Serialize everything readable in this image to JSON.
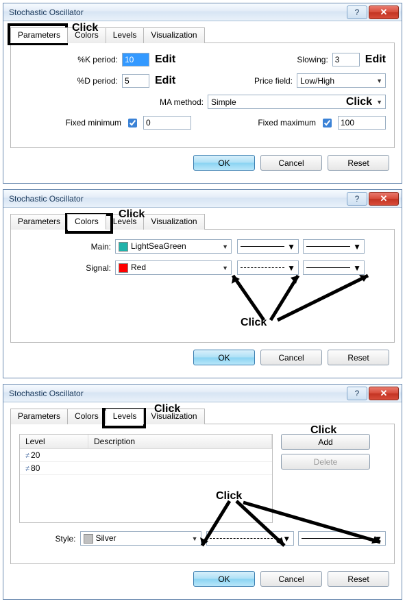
{
  "title": "Stochastic Oscillator",
  "tabs": {
    "parameters": "Parameters",
    "colors": "Colors",
    "levels": "Levels",
    "visualization": "Visualization"
  },
  "buttons": {
    "ok": "OK",
    "cancel": "Cancel",
    "reset": "Reset",
    "add": "Add",
    "delete": "Delete"
  },
  "annotations": {
    "click": "Click",
    "edit": "Edit"
  },
  "dlg1": {
    "k_period_label": "%K period:",
    "k_period_value": "10",
    "slowing_label": "Slowing:",
    "slowing_value": "3",
    "d_period_label": "%D period:",
    "d_period_value": "5",
    "price_field_label": "Price field:",
    "price_field_value": "Low/High",
    "ma_method_label": "MA method:",
    "ma_method_value": "Simple",
    "fixed_min_label": "Fixed minimum",
    "fixed_min_value": "0",
    "fixed_max_label": "Fixed maximum",
    "fixed_max_value": "100"
  },
  "dlg2": {
    "main_label": "Main:",
    "main_color_name": "LightSeaGreen",
    "main_color": "#20B2AA",
    "signal_label": "Signal:",
    "signal_color_name": "Red",
    "signal_color": "#ff0000"
  },
  "dlg3": {
    "col_level": "Level",
    "col_desc": "Description",
    "rows": [
      {
        "v": "20"
      },
      {
        "v": "80"
      }
    ],
    "style_label": "Style:",
    "style_color_name": "Silver",
    "style_color": "#c0c0c0"
  }
}
